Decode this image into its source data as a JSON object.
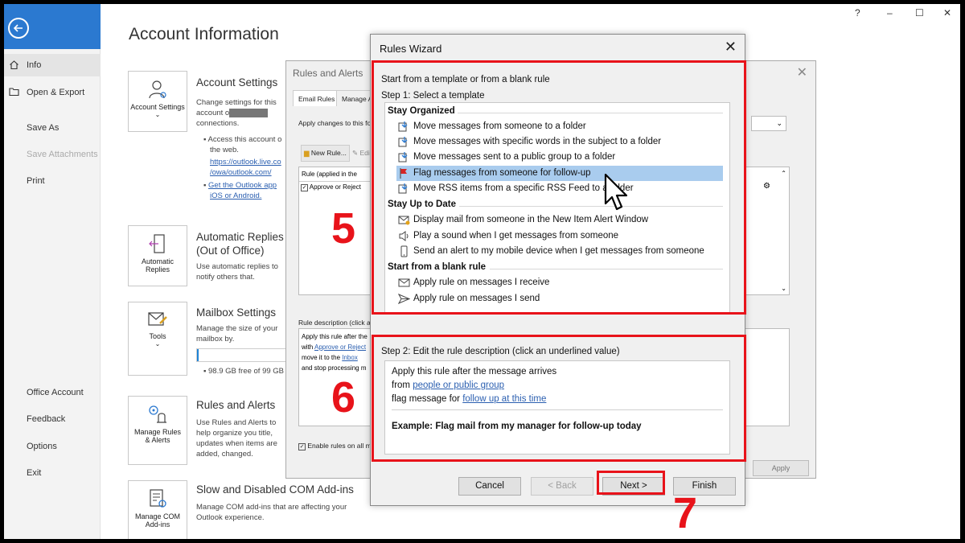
{
  "window_controls": {
    "help": "?",
    "minimize": "–",
    "maximize": "☐",
    "close": "✕"
  },
  "sidebar": {
    "items": [
      {
        "label": "Info"
      },
      {
        "label": "Open & Export"
      },
      {
        "label": "Save As"
      },
      {
        "label": "Save Attachments"
      },
      {
        "label": "Print"
      },
      {
        "label": "Office Account"
      },
      {
        "label": "Feedback"
      },
      {
        "label": "Options"
      },
      {
        "label": "Exit"
      }
    ]
  },
  "main": {
    "title": "Account Information",
    "account_settings": {
      "card_label": "Account Settings",
      "title": "Account Settings",
      "text1": "Change settings for this",
      "text2": "account o",
      "text3": "connections.",
      "bullet1": "Access this account o",
      "bullet1b": "the web.",
      "link1a": "https://outlook.live.co",
      "link1b": "/owa/outlook.com/",
      "link2a": "Get the Outlook app",
      "link2b": "iOS or Android."
    },
    "auto_replies": {
      "card_label": "Automatic Replies",
      "title1": "Automatic Replies",
      "title2": "(Out of Office)",
      "text1": "Use automatic replies to",
      "text2": "notify others that."
    },
    "mailbox": {
      "card_label": "Tools",
      "title": "Mailbox Settings",
      "text1": "Manage the size of your",
      "text2": "mailbox by.",
      "storage": "98.9 GB free of 99 GB",
      "used_fraction": 0.02
    },
    "rules": {
      "card_label": "Manage Rules & Alerts",
      "title": "Rules and Alerts",
      "text1": "Use Rules and Alerts to",
      "text2": "help organize you title,",
      "text3": "updates when items are",
      "text4": "added, changed."
    },
    "com": {
      "card_label": "Manage COM Add-ins",
      "title": "Slow and Disabled COM Add-ins",
      "text1": "Manage COM add-ins that are affecting your",
      "text2": "Outlook experience."
    }
  },
  "rules_alerts": {
    "title": "Rules and Alerts",
    "tab_email_rules": "Email Rules",
    "tab_manage": "Manage A",
    "apply_changes": "Apply changes to this fol",
    "new_rule": "New Rule...",
    "edit": "Edi",
    "col_rule": "Rule (applied in the",
    "rule_row": "Approve or Reject",
    "rule_desc_label": "Rule description (click an",
    "desc1": "Apply this rule after the",
    "desc2a": "with ",
    "desc2_link": "Approve or Reject",
    "desc3a": "move it to the ",
    "desc3_link": "Inbox",
    "desc4": "and stop processing m",
    "enable_rules": "Enable rules on all me",
    "apply_btn": "Apply"
  },
  "wizard": {
    "title": "Rules Wizard",
    "heading": "Start from a template or from a blank rule",
    "step1": "Step 1: Select a template",
    "groups": [
      {
        "label": "Stay Organized"
      },
      {
        "label": "Stay Up to Date"
      },
      {
        "label": "Start from a blank rule"
      }
    ],
    "templates": [
      {
        "label": "Move messages from someone to a folder",
        "icon": "move-folder-icon"
      },
      {
        "label": "Move messages with specific words in the subject to a folder",
        "icon": "move-folder-icon"
      },
      {
        "label": "Move messages sent to a public group to a folder",
        "icon": "move-folder-icon"
      },
      {
        "label": "Flag messages from someone for follow-up",
        "icon": "flag-icon"
      },
      {
        "label": "Move RSS items from a specific RSS Feed to a folder",
        "icon": "move-folder-icon"
      },
      {
        "label": "Display mail from someone in the New Item Alert Window",
        "icon": "mail-alert-icon"
      },
      {
        "label": "Play a sound when I get messages from someone",
        "icon": "speaker-icon"
      },
      {
        "label": "Send an alert to my mobile device when I get messages from someone",
        "icon": "mobile-icon"
      },
      {
        "label": "Apply rule on messages I receive",
        "icon": "envelope-icon"
      },
      {
        "label": "Apply rule on messages I send",
        "icon": "send-icon"
      }
    ],
    "step2": "Step 2: Edit the rule description (click an underlined value)",
    "desc_line1": "Apply this rule after the message arrives",
    "desc_line2a": "from ",
    "desc_line2_link": "people or public group",
    "desc_line3a": "flag message for ",
    "desc_line3_link": "follow up at this time",
    "example": "Example: Flag mail from my manager for follow-up today",
    "buttons": {
      "cancel": "Cancel",
      "back": "< Back",
      "next": "Next >",
      "finish": "Finish"
    }
  },
  "annotations": {
    "step5": "5",
    "step6": "6",
    "step7": "7"
  },
  "colors": {
    "accent": "#2b79d0",
    "selection": "#a9ccee",
    "annotation": "#e8131a",
    "link": "#2b5fb0"
  }
}
